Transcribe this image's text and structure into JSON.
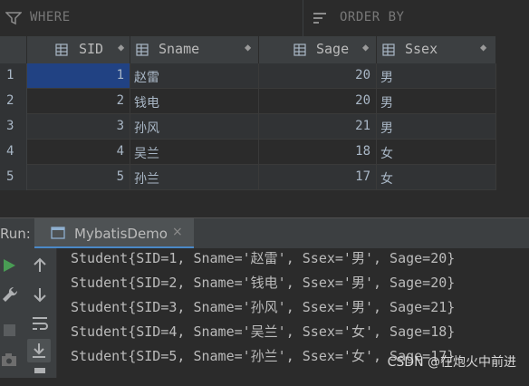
{
  "filter": {
    "where_label": "WHERE",
    "order_label": "ORDER BY"
  },
  "table": {
    "columns": [
      "SID",
      "Sname",
      "Sage",
      "Ssex"
    ],
    "rows": [
      {
        "num": "1",
        "SID": "1",
        "Sname": "赵雷",
        "Sage": "20",
        "Ssex": "男"
      },
      {
        "num": "2",
        "SID": "2",
        "Sname": "钱电",
        "Sage": "20",
        "Ssex": "男"
      },
      {
        "num": "3",
        "SID": "3",
        "Sname": "孙风",
        "Sage": "21",
        "Ssex": "男"
      },
      {
        "num": "4",
        "SID": "4",
        "Sname": "吴兰",
        "Sage": "18",
        "Ssex": "女"
      },
      {
        "num": "5",
        "SID": "5",
        "Sname": "孙兰",
        "Sage": "17",
        "Ssex": "女"
      }
    ]
  },
  "run": {
    "label": "Run:",
    "tab_label": "MybatisDemo",
    "close_glyph": "×"
  },
  "console": {
    "lines": [
      "Student{SID=1, Sname='赵雷', Ssex='男', Sage=20}",
      "Student{SID=2, Sname='钱电', Ssex='男', Sage=20}",
      "Student{SID=3, Sname='孙风', Ssex='男', Sage=21}",
      "Student{SID=4, Sname='吴兰', Ssex='女', Sage=18}",
      "Student{SID=5, Sname='孙兰', Ssex='女', Sage=17}"
    ]
  },
  "watermark": "CSDN @在炮火中前进",
  "icons": {
    "filter": "filter-icon",
    "sort": "sort-lines-icon",
    "column": "column-key-icon",
    "run": "play-icon",
    "wrench": "wrench-icon",
    "up": "arrow-up-icon",
    "down": "arrow-down-icon",
    "stop": "stop-icon",
    "wrap": "soft-wrap-icon",
    "scroll": "scroll-to-end-icon",
    "camera": "camera-icon",
    "print": "print-icon"
  },
  "colors": {
    "selection": "#214283",
    "accent": "#4a88c7",
    "run_green": "#499c54"
  }
}
